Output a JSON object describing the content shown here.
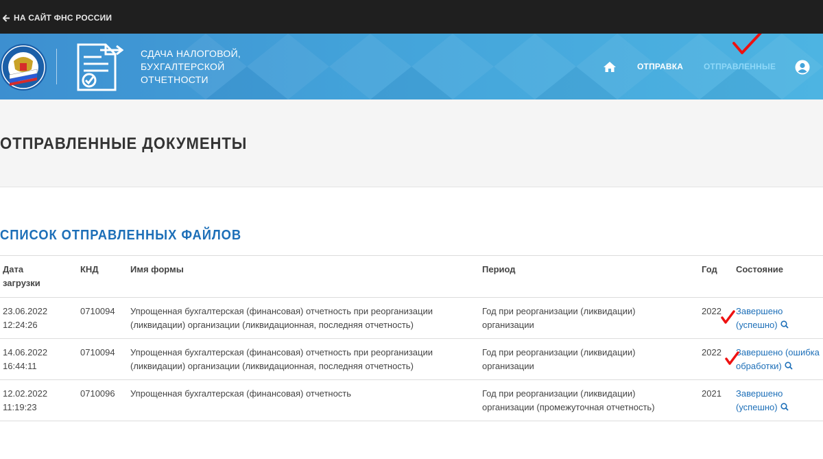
{
  "topbar": {
    "back_link": "НА САЙТ ФНС РОССИИ"
  },
  "header": {
    "title_lines": [
      "СДАЧА НАЛОГОВОЙ,",
      "БУХГАЛТЕРСКОЙ",
      "ОТЧЕТНОСТИ"
    ],
    "nav": {
      "send": "ОТПРАВКА",
      "sent": "ОТПРАВЛЕННЫЕ"
    },
    "icons": {
      "home": "home-icon",
      "user": "user-icon",
      "emblem": "fns-emblem"
    },
    "colors": {
      "active_nav": "#8fd8f8",
      "header_blue": "#43a3da"
    }
  },
  "page": {
    "title": "ОТПРАВЛЕННЫЕ ДОКУМЕНТЫ",
    "section_title": "СПИСОК ОТПРАВЛЕННЫХ ФАЙЛОВ"
  },
  "table": {
    "headers": {
      "date_line1": "Дата",
      "date_line2": "загрузки",
      "knd": "КНД",
      "form": "Имя формы",
      "period": "Период",
      "year": "Год",
      "status": "Состояние"
    },
    "rows": [
      {
        "date": "23.06.2022",
        "time": "12:24:26",
        "knd": "0710094",
        "form_line1": "Упрощенная бухгалтерская (финансовая) отчетность при реорганизации",
        "form_line2": "(ликвидации) организации (ликвидационная, последняя отчетность)",
        "period_line1": "Год при реорганизации (ликвидации)",
        "period_line2": "организации",
        "year": "2022",
        "status_line1": "Завершено",
        "status_line2": "(успешно)"
      },
      {
        "date": "14.06.2022",
        "time": "16:44:11",
        "knd": "0710094",
        "form_line1": "Упрощенная бухгалтерская (финансовая) отчетность при реорганизации",
        "form_line2": "(ликвидации) организации (ликвидационная, последняя отчетность)",
        "period_line1": "Год при реорганизации (ликвидации)",
        "period_line2": "организации",
        "year": "2022",
        "status_line1": "Завершено (ошибка",
        "status_line2": "обработки)"
      },
      {
        "date": "12.02.2022",
        "time": "11:19:23",
        "knd": "0710096",
        "form_line1": "Упрощенная бухгалтерская (финансовая) отчетность",
        "form_line2": "",
        "period_line1": "Год при реорганизации (ликвидации)",
        "period_line2": "организации (промежуточная отчетность)",
        "year": "2021",
        "status_line1": "Завершено",
        "status_line2": "(успешно)"
      }
    ]
  }
}
